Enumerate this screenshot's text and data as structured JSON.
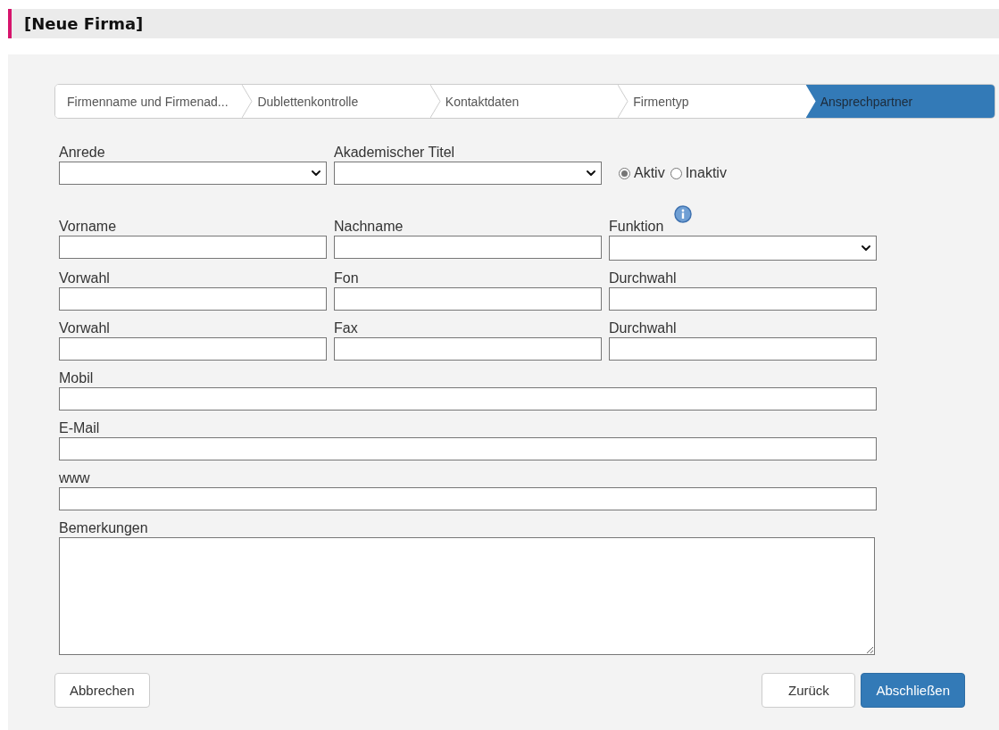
{
  "header": {
    "title": "[Neue Firma]"
  },
  "steps": [
    {
      "label": "Firmenname und Firmenad...",
      "selected": false
    },
    {
      "label": "Dublettenkontrolle",
      "selected": false
    },
    {
      "label": "Kontaktdaten",
      "selected": false
    },
    {
      "label": "Firmentyp",
      "selected": false
    },
    {
      "label": "Ansprechpartner",
      "selected": true
    }
  ],
  "form": {
    "rows": [
      [
        {
          "kind": "select",
          "label": "Anrede"
        },
        {
          "kind": "select",
          "label": "Akademischer Titel"
        },
        {
          "kind": "radios",
          "options": [
            {
              "label": "Aktiv",
              "selected": true
            },
            {
              "label": "Inaktiv",
              "selected": false
            }
          ]
        }
      ],
      [
        {
          "kind": "text",
          "label": "Vorname"
        },
        {
          "kind": "text",
          "label": "Nachname"
        },
        {
          "kind": "select",
          "label": "Funktion",
          "info": true
        }
      ],
      [
        {
          "kind": "text",
          "label": "Vorwahl"
        },
        {
          "kind": "text",
          "label": "Fon"
        },
        {
          "kind": "text",
          "label": "Durchwahl"
        }
      ],
      [
        {
          "kind": "text",
          "label": "Vorwahl"
        },
        {
          "kind": "text",
          "label": "Fax"
        },
        {
          "kind": "text",
          "label": "Durchwahl"
        }
      ],
      [
        {
          "kind": "wide",
          "label": "Mobil"
        }
      ],
      [
        {
          "kind": "wide",
          "label": "E-Mail"
        }
      ],
      [
        {
          "kind": "wide",
          "label": "www"
        }
      ],
      [
        {
          "kind": "textarea",
          "label": "Bemerkungen"
        }
      ]
    ]
  },
  "buttons": {
    "left": [
      {
        "label": "Abbrechen",
        "kind": "secondary"
      }
    ],
    "right": [
      {
        "label": "Zurück",
        "kind": "secondary"
      },
      {
        "label": "Abschließen",
        "kind": "primary"
      }
    ]
  }
}
